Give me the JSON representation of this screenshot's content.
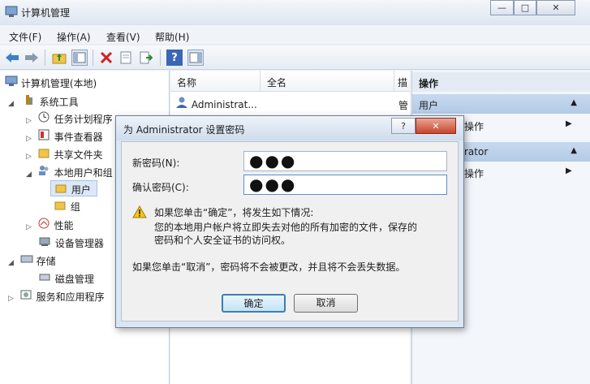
{
  "window": {
    "title": "计算机管理"
  },
  "menu": [
    "文件(F)",
    "操作(A)",
    "查看(V)",
    "帮助(H)"
  ],
  "tree": {
    "root": "计算机管理(本地)",
    "system_tools": "系统工具",
    "task_scheduler": "任务计划程序",
    "event_viewer": "事件查看器",
    "shared_folders": "共享文件夹",
    "local_users": "本地用户和组",
    "users": "用户",
    "groups": "组",
    "performance": "性能",
    "device_manager": "设备管理器",
    "storage": "存储",
    "disk_management": "磁盘管理",
    "services_apps": "服务和应用程序"
  },
  "list": {
    "columns": [
      "名称",
      "全名",
      "描"
    ],
    "rows": [
      {
        "name": "Administrat...",
        "desc": "管"
      }
    ]
  },
  "actions": {
    "header": "操作",
    "section1": "用户",
    "more1": "更多操作",
    "section2": "Administrator",
    "more2": "更多操作",
    "more1_visible": "操作",
    "section2_visible": "rator",
    "more2_visible": "操作"
  },
  "dialog": {
    "title": "为 Administrator 设置密码",
    "new_password_label": "新密码(N):",
    "new_password_value": "●●●",
    "confirm_label": "确认密码(C):",
    "confirm_value": "●●●",
    "warning_title": "如果您单击“确定”，将发生如下情况:",
    "warning_line1": "您的本地用户帐户将立即失去对他的所有加密的文件，保存的",
    "warning_line2": "密码和个人安全证书的访问权。",
    "cancel_note": "如果您单击“取消”，密码将不会被更改，并且将不会丢失数据。",
    "ok_label": "确定",
    "cancel_label": "取消",
    "help_glyph": "?",
    "close_glyph": "✕"
  }
}
